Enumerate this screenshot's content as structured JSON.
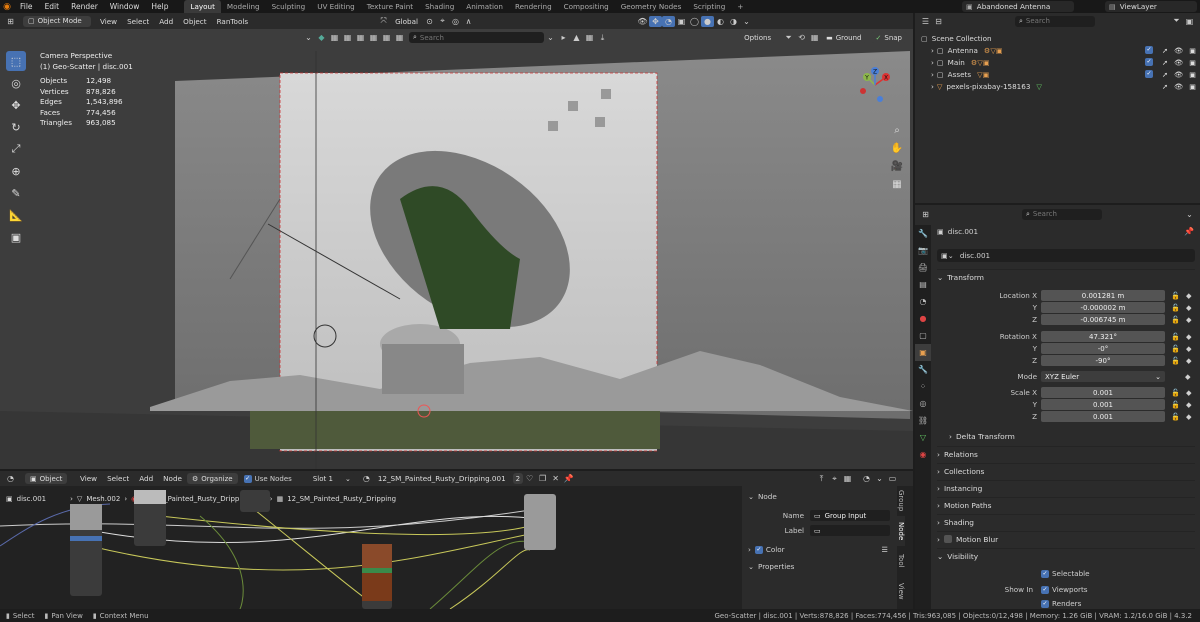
{
  "topbar": {
    "menus": [
      "File",
      "Edit",
      "Render",
      "Window",
      "Help"
    ],
    "workspaces": [
      "Layout",
      "Modeling",
      "Sculpting",
      "UV Editing",
      "Texture Paint",
      "Shading",
      "Animation",
      "Rendering",
      "Compositing",
      "Geometry Nodes",
      "Scripting"
    ],
    "active_workspace": "Layout",
    "add_tab": "+",
    "scene_name": "Abandoned Antenna",
    "view_layer": "ViewLayer"
  },
  "viewport_header": {
    "mode": "Object Mode",
    "menus": [
      "View",
      "Select",
      "Add",
      "Object",
      "RanTools"
    ],
    "orientation": "Global",
    "search_placeholder": "Search",
    "options": "Options",
    "ground": "Ground",
    "snap": "Snap"
  },
  "viewport": {
    "camera_label": "Camera Perspective",
    "object_label": "(1) Geo-Scatter | disc.001",
    "stats": [
      {
        "label": "Objects",
        "value": "12,498"
      },
      {
        "label": "Vertices",
        "value": "878,826"
      },
      {
        "label": "Edges",
        "value": "1,543,896"
      },
      {
        "label": "Faces",
        "value": "774,456"
      },
      {
        "label": "Triangles",
        "value": "963,085"
      }
    ],
    "gizmo": {
      "x": "X",
      "y": "Y",
      "z": "Z"
    }
  },
  "outliner": {
    "search_placeholder": "Search",
    "root": "Scene Collection",
    "items": [
      {
        "label": "Antenna"
      },
      {
        "label": "Main"
      },
      {
        "label": "Assets"
      },
      {
        "label": "pexels-pixabay-158163"
      }
    ]
  },
  "properties": {
    "search_placeholder": "Search",
    "object_name": "disc.001",
    "data_name": "disc.001",
    "transform": {
      "title": "Transform",
      "location_label": "Location X",
      "location": [
        "0.001281 m",
        "-0.000002 m",
        "-0.006745 m"
      ],
      "rotation_label": "Rotation X",
      "rotation": [
        "47.321°",
        "-0°",
        "-90°"
      ],
      "mode_label": "Mode",
      "mode": "XYZ Euler",
      "scale_label": "Scale X",
      "scale": [
        "0.001",
        "0.001",
        "0.001"
      ],
      "axis_y": "Y",
      "axis_z": "Z"
    },
    "panels": [
      "Delta Transform",
      "Relations",
      "Collections",
      "Instancing",
      "Motion Paths",
      "Shading",
      "Motion Blur",
      "Visibility"
    ],
    "visibility": {
      "selectable": "Selectable",
      "show_in": "Show In",
      "viewports": "Viewports",
      "renders": "Renders"
    }
  },
  "node_editor": {
    "editor_type": "Object",
    "menus": [
      "View",
      "Select",
      "Add",
      "Node"
    ],
    "organize": "Organize",
    "use_nodes": "Use Nodes",
    "slot": "Slot 1",
    "material": "12_SM_Painted_Rusty_Dripping.001",
    "users": "2",
    "breadcrumb": [
      "disc.001",
      "Mesh.002",
      "12_SM_Painted_Rusty_Dripping.001",
      "12_SM_Painted_Rusty_Dripping"
    ]
  },
  "node_sidebar": {
    "section": "Node",
    "name_label": "Name",
    "name_value": "Group Input",
    "label_label": "Label",
    "color_label": "Color",
    "properties_label": "Properties",
    "tabs": [
      "Group",
      "Node",
      "Tool",
      "View"
    ]
  },
  "statusbar": {
    "select": "Select",
    "pan": "Pan View",
    "context": "Context Menu",
    "info": "Geo-Scatter | disc.001 | Verts:878,826 | Faces:774,456 | Tris:963,085 | Objects:0/12,498 | Memory: 1.26 GiB | VRAM: 1.2/16.0 GiB | 4.3.2"
  }
}
